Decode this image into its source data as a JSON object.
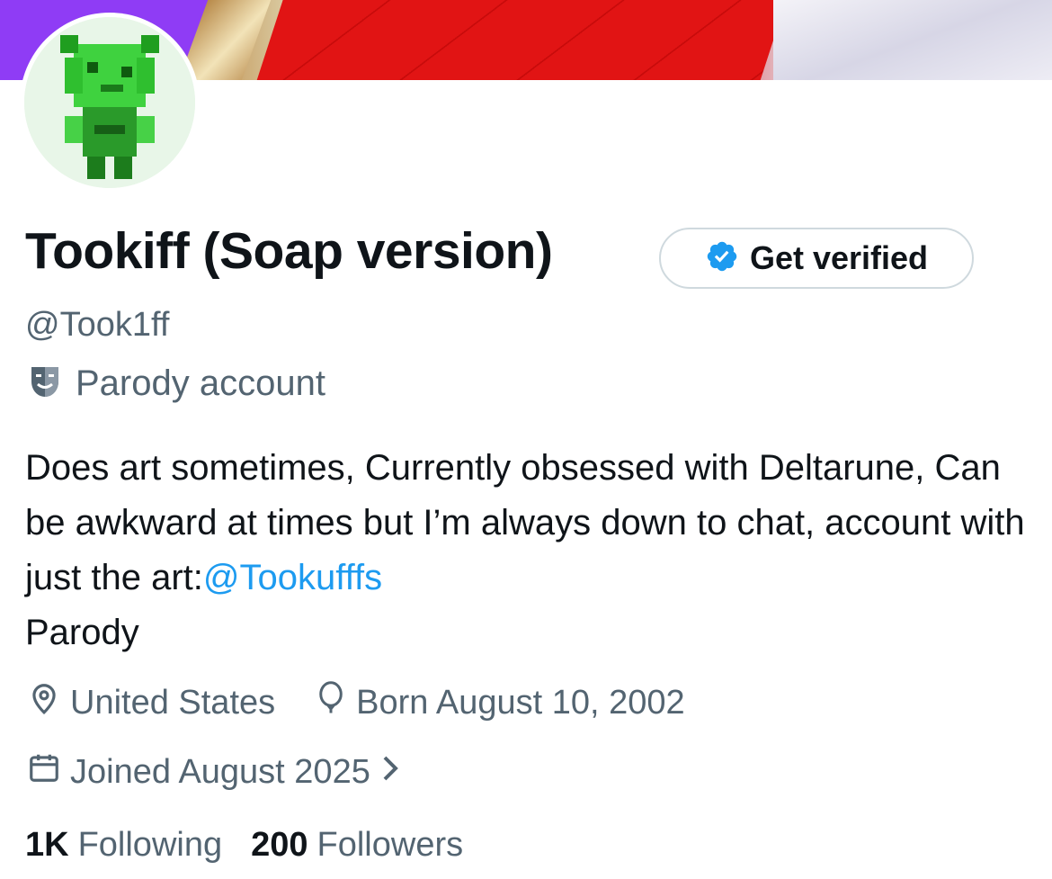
{
  "profile": {
    "display_name": "Tookiff (Soap version)",
    "handle": "@Took1ff",
    "verify_button": "Get verified",
    "account_label": "Parody account",
    "bio": {
      "text": "Does art sometimes, Currently obsessed with Deltarune, Can be awkward at times but I’m always down to chat, account with just the art:",
      "mention": "@Tookufffs",
      "tail": "Parody"
    },
    "location": "United States",
    "birthday": "Born August 10, 2002",
    "joined": "Joined August 2025",
    "following_count": "1K",
    "following_label": "Following",
    "followers_count": "200",
    "followers_label": "Followers"
  },
  "icons": {
    "verify": "verified-badge-icon",
    "parody": "theater-mask-icon",
    "location": "location-pin-icon",
    "birthday": "balloon-icon",
    "joined": "calendar-icon",
    "chevron": "chevron-right-icon"
  },
  "colors": {
    "text": "#0f1419",
    "secondary": "#536471",
    "link": "#1d9bf0",
    "verified_blue": "#1d9bf0",
    "border": "#cfd9de"
  }
}
